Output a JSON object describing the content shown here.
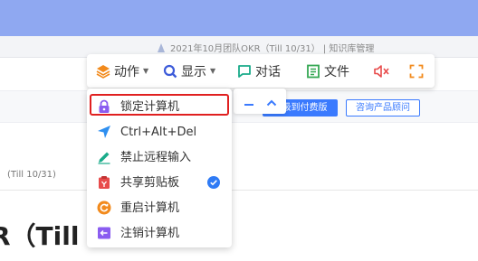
{
  "background": {
    "doc_title": "2021年10月团队OKR（Till 10/31） | 知识库管理",
    "upgrade_button": "升级到付费版",
    "consult_button": "咨询产品顾问",
    "sub_heading": "(Till 10/31)",
    "big_title": "R（Till 1"
  },
  "toolbar": {
    "action_label": "动作",
    "display_label": "显示",
    "chat_label": "对话",
    "file_label": "文件",
    "icons": {
      "action": "layers-icon",
      "display": "search-icon",
      "chat": "chat-bubble-icon",
      "file": "document-icon",
      "mute": "speaker-mute-icon",
      "fullscreen": "fullscreen-icon"
    },
    "colors": {
      "action": "#f28a1c",
      "display": "#3d5bd9",
      "chat": "#1aab8a",
      "file": "#35a853",
      "mute": "#e84b4b",
      "fullscreen": "#f28a1c"
    }
  },
  "mini_controls": {
    "minimize_icon": "minus-icon",
    "collapse_icon": "chevron-up-icon"
  },
  "menu": {
    "items": [
      {
        "label": "锁定计算机",
        "icon": "lock-icon",
        "color": "#8a5cf0",
        "checked": false
      },
      {
        "label": "Ctrl+Alt+Del",
        "icon": "send-arrow-icon",
        "color": "#2f8ff0",
        "checked": false
      },
      {
        "label": "禁止远程输入",
        "icon": "pen-icon",
        "color": "#1aab8a",
        "checked": false
      },
      {
        "label": "共享剪贴板",
        "icon": "clipboard-icon",
        "color": "#e84b4b",
        "checked": true
      },
      {
        "label": "重启计算机",
        "icon": "restart-icon",
        "color": "#f28a1c",
        "checked": false
      },
      {
        "label": "注销计算机",
        "icon": "logout-icon",
        "color": "#8a5cf0",
        "checked": false
      }
    ],
    "check_color": "#2f7bf5",
    "highlight_color": "#e02020"
  }
}
